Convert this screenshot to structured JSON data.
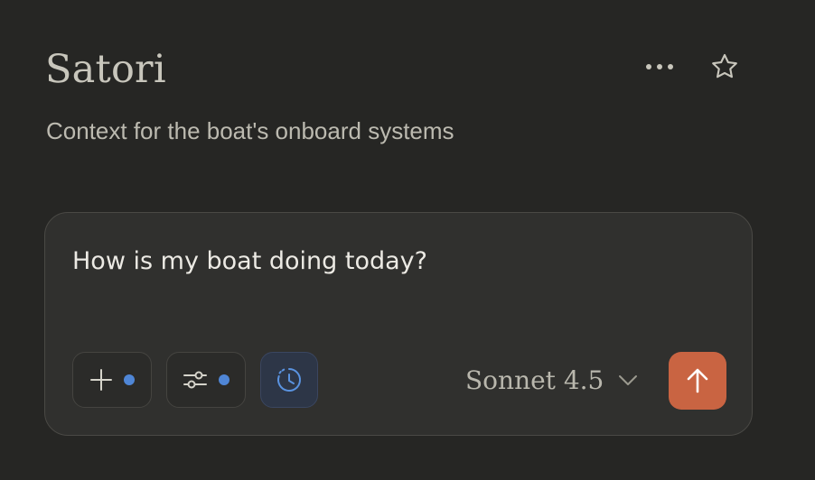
{
  "project": {
    "title": "Satori",
    "description": "Context for the boat's onboard systems"
  },
  "header": {
    "more_icon": "more-horizontal-icon",
    "star_icon": "star-icon"
  },
  "composer": {
    "prompt_text": "How is my boat doing today?",
    "add_icon": "plus-icon",
    "tools_icon": "sliders-icon",
    "research_icon": "clock-icon",
    "research_active": true,
    "model_label": "Sonnet 4.5",
    "model_dropdown_icon": "chevron-down-icon",
    "send_icon": "arrow-up-icon"
  },
  "colors": {
    "background": "#262624",
    "composer_bg": "#30302e",
    "accent_send": "#c96442",
    "indicator_dot": "#4f86d6",
    "active_tool_bg": "#2d3647"
  }
}
